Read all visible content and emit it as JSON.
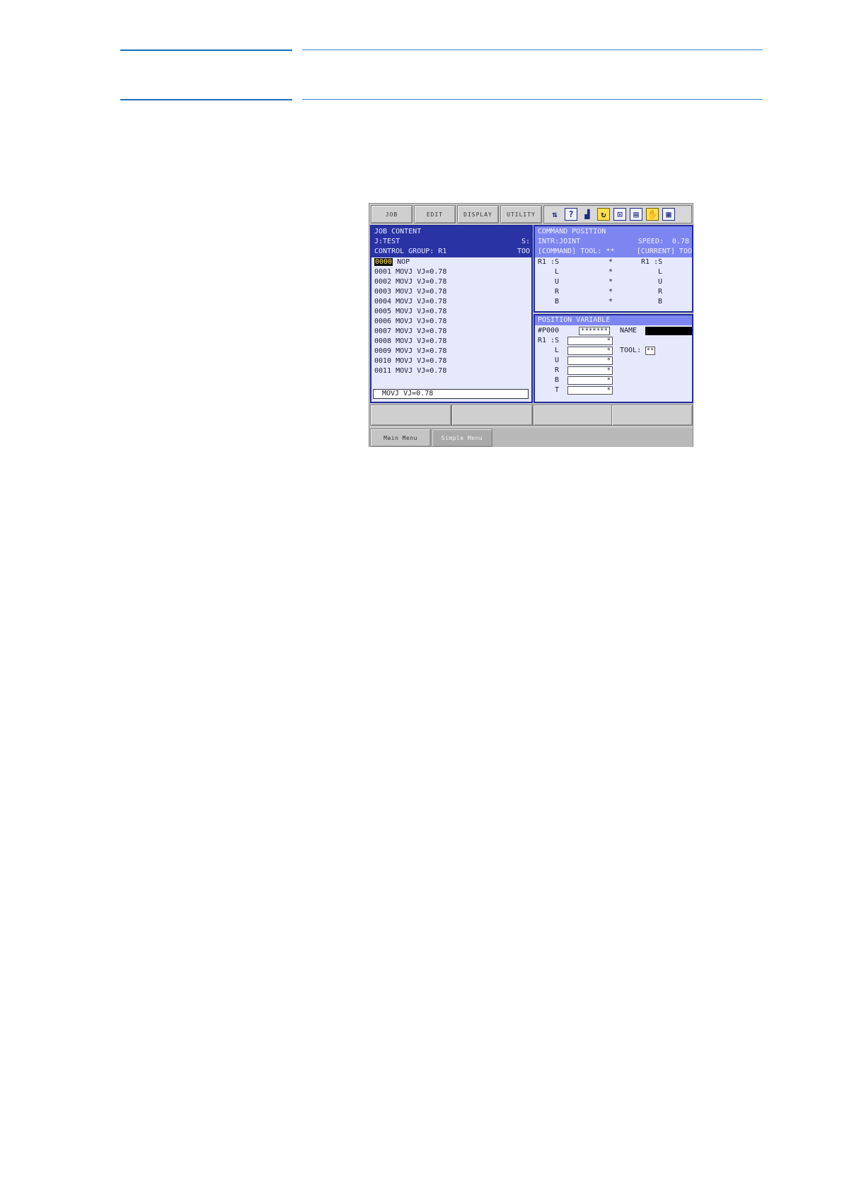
{
  "menu": {
    "job": "JOB",
    "edit": "EDIT",
    "display": "DISPLAY",
    "utility": "UTILITY"
  },
  "icons": [
    "axis-icon",
    "help-icon",
    "signal-icon",
    "coordinate-icon",
    "servo-icon",
    "teach-lock-icon",
    "hand-icon",
    "grid-icon"
  ],
  "job_content": {
    "title": "JOB CONTENT",
    "job_name": "J:TEST",
    "step": "S:",
    "control_group": "CONTROL GROUP: R1",
    "tool": "TOO",
    "cursor_line": "0000",
    "cursor_text": " NOP",
    "lines": [
      "0001 MOVJ VJ=0.78",
      "0002 MOVJ VJ=0.78",
      "0003 MOVJ VJ=0.78",
      "0004 MOVJ VJ=0.78",
      "0005 MOVJ VJ=0.78",
      "0006 MOVJ VJ=0.78",
      "0007 MOVJ VJ=0.78",
      "0008 MOVJ VJ=0.78",
      "0009 MOVJ VJ=0.78",
      "0010 MOVJ VJ=0.78",
      "0011 MOVJ VJ=0.78"
    ],
    "edit_buffer": "MOVJ VJ=0.78"
  },
  "command_position": {
    "title": "COMMAND POSITION",
    "interp": "INTR:JOINT",
    "speed": "SPEED:  0.78",
    "command_tool": "[COMMAND] TOOL: **",
    "current_tool": "[CURRENT] TOO",
    "group": "R1 :S",
    "group_right": "R1 :S",
    "axes": [
      "L",
      "U",
      "R",
      "B"
    ],
    "value": "*"
  },
  "position_variable": {
    "title": "POSITION VARIABLE",
    "var_id": "#P000",
    "var_value": "*******",
    "name_label": "NAME",
    "group": "R1 :S",
    "axes": [
      "L",
      "U",
      "R",
      "B",
      "T"
    ],
    "value": "*",
    "tool_label": "TOOL:",
    "tool_value": "**"
  },
  "bottom": {
    "main_menu": "Main Menu",
    "simple_menu": "Simple Menu"
  }
}
